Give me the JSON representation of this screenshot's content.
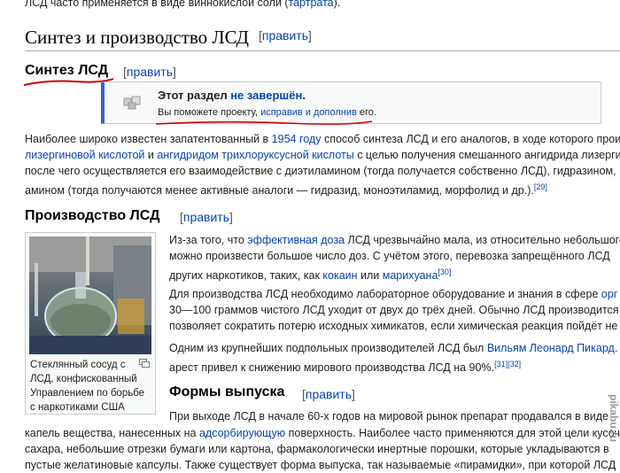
{
  "top_line": {
    "text": "ЛСД часто применяется в виде виннокислой соли (",
    "link": "тартрата",
    "tail": ")."
  },
  "edit": {
    "open": "[",
    "label": "править",
    "close": "]"
  },
  "section_synthesis": {
    "title": "Синтез и производство ЛСД"
  },
  "sub_synthesis": {
    "title": "Синтез ЛСД"
  },
  "notice": {
    "line1_pre": "Этот раздел ",
    "line1_link": "не завершён",
    "line1_post": ".",
    "line2_pre": "Вы поможете проекту, ",
    "line2_link": "исправив и дополнив",
    "line2_post": " его."
  },
  "synthesis_para": {
    "l1_pre": "Наиболее широко известен запатентованный в ",
    "l1_link": "1954 году",
    "l1_post": " способ синтеза ЛСД и его аналогов, в ходе которого прои",
    "l2_link1": "лизергиновой кислотой",
    "l2_mid": " и ",
    "l2_link2": "ангидридом трихлоруксусной кислоты",
    "l2_post": " с целью получения смешанного ангидрида лизергин",
    "l3": "после чего осуществляется его взаимодействие с диэтиламином (тогда получается собственно ЛСД), гидразином,",
    "l4": "амином (тогда получаются менее активные аналоги — гидразид, моноэтиламид, морфолид и др.).",
    "l4_ref": "[29]"
  },
  "sub_production": {
    "title": "Производство ЛСД"
  },
  "production_para1": {
    "l1_pre": "Из-за того, что ",
    "l1_link": "эффективная доза",
    "l1_post": " ЛСД чрезвычайно мала, из относительно небольшого",
    "l2": "можно произвести большое число доз. С учётом этого, перевозка запрещённого ЛСД ",
    "l3_pre": "других наркотиков, таких, как ",
    "l3_link1": "кокаин",
    "l3_mid": " или ",
    "l3_link2": "марихуана",
    "l3_ref": "[30]"
  },
  "production_para2": {
    "l1_pre": "Для производства ЛСД необходимо лабораторное оборудование и знания в сфере ",
    "l1_link": "орг",
    "l2": "30—100 граммов чистого ЛСД уходит от двух до трёх дней. Обычно ЛСД производится",
    "l3": "позволяет сократить потерю исходных химикатов, если химическая реакция пойдёт не"
  },
  "production_para3": {
    "l1_pre": "Одним из крупнейших подпольных производителей ЛСД был ",
    "l1_link": "Вильям Леонард Пикард",
    "l1_post": ". Е",
    "l2": "арест привел к снижению мирового производства ЛСД на 90%.",
    "l2_ref": "[31][32]"
  },
  "thumb": {
    "caption_l1": "Стеклянный сосуд с",
    "caption_l2": "ЛСД, конфискованный",
    "caption_l3": "Управлением по борьбе",
    "caption_l4": "с наркотиками США"
  },
  "sub_forms": {
    "title": "Формы выпуска"
  },
  "forms_para": {
    "l1": "При выходе ЛСД в начале 60-х годов на мировой рынок препарат продавался в виде",
    "l2_pre": "капель вещества, нанесенных на ",
    "l2_link": "адсорбирующую",
    "l2_post": " поверхность. Наиболее часто применяются для этой цели кусоч",
    "l3": "сахара, небольшие отрезки бумаги или картона, фармакологически инертные порошки, которые укладываются в",
    "l4": "пустые желатиновые капсулы. Также существует форма выпуска, так называемые «пирамидки», при которой ЛСД"
  },
  "watermark": "pikabu.ru",
  "colors": {
    "link": "#0645ad",
    "underline_red": "#d10000",
    "notice_accent": "#3366cc"
  }
}
